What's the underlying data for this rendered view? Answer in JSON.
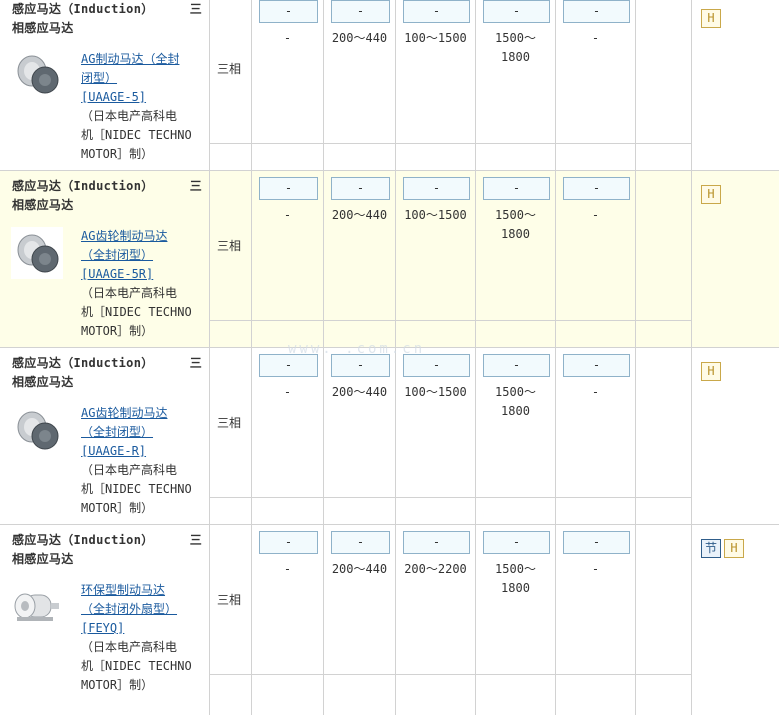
{
  "rows": [
    {
      "category": "感应马达（Induction）",
      "category2": "三",
      "category3": "相感应马达",
      "name_lines": [
        "AG制动马达（全封",
        "闭型）",
        "[UAAGE-5]"
      ],
      "maker_lines": [
        "（日本电产高科电",
        "机［NIDEC TECHNO",
        "MOTOR］制）"
      ],
      "phase": "三相",
      "buttons": [
        "-",
        "-",
        "-",
        "-",
        "-"
      ],
      "values": [
        "-",
        "200～440",
        "100～1500",
        "1500～",
        "-"
      ],
      "value2": "1800",
      "tags": [
        "H"
      ],
      "image": "motor-gray"
    },
    {
      "category": "感应马达（Induction）",
      "category2": "三",
      "category3": "相感应马达",
      "name_lines": [
        "AG齿轮制动马达",
        "（全封闭型）",
        "[UAAGE-5R]"
      ],
      "maker_lines": [
        "（日本电产高科电",
        "机［NIDEC TECHNO",
        "MOTOR］制）"
      ],
      "phase": "三相",
      "buttons": [
        "-",
        "-",
        "-",
        "-",
        "-"
      ],
      "values": [
        "-",
        "200～440",
        "100～1500",
        "1500～",
        "-"
      ],
      "value2": "1800",
      "tags": [
        "H"
      ],
      "image": "motor-gray"
    },
    {
      "category": "感应马达（Induction）",
      "category2": "三",
      "category3": "相感应马达",
      "name_lines": [
        "AG齿轮制动马达",
        "（全封闭型）",
        "[UAAGE-R]"
      ],
      "maker_lines": [
        "（日本电产高科电",
        "机［NIDEC TECHNO",
        "MOTOR］制）"
      ],
      "phase": "三相",
      "buttons": [
        "-",
        "-",
        "-",
        "-",
        "-"
      ],
      "values": [
        "-",
        "200～440",
        "100～1500",
        "1500～",
        "-"
      ],
      "value2": "1800",
      "tags": [
        "H"
      ],
      "image": "motor-gray"
    },
    {
      "category": "感应马达（Induction）",
      "category2": "三",
      "category3": "相感应马达",
      "name_lines": [
        "环保型制动马达",
        "（全封闭外扇型）",
        "[FEYQ]"
      ],
      "maker_lines": [
        "（日本电产高科电",
        "机［NIDEC TECHNO",
        "MOTOR］制）"
      ],
      "phase": "三相",
      "buttons": [
        "-",
        "-",
        "-",
        "-",
        "-"
      ],
      "values": [
        "-",
        "200～440",
        "200～2200",
        "1500～",
        "-"
      ],
      "value2": "1800",
      "tags": [
        "节",
        "H"
      ],
      "image": "motor-white"
    }
  ],
  "watermark": "www.  .com.cn"
}
